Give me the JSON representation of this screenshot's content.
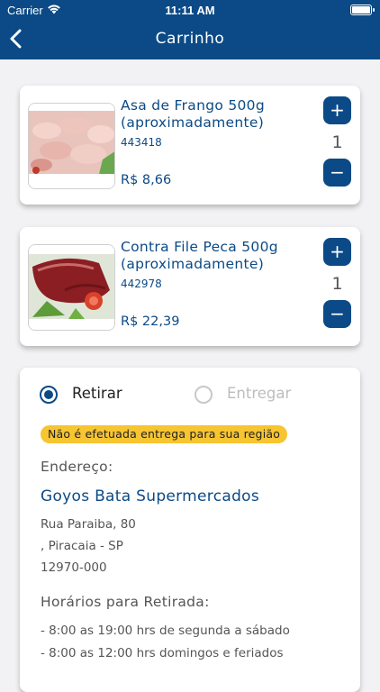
{
  "status_bar": {
    "carrier": "Carrier",
    "time": "11:11 AM"
  },
  "header": {
    "title": "Carrinho"
  },
  "cart": {
    "items": [
      {
        "name": "Asa de Frango 500g (aproximadamente)",
        "code": "443418",
        "price": "R$ 8,66",
        "quantity": "1",
        "plus": "+",
        "minus": "−"
      },
      {
        "name": "Contra File Peca 500g (aproximadamente)",
        "code": "442978",
        "price": "R$ 22,39",
        "quantity": "1",
        "plus": "+",
        "minus": "−"
      }
    ]
  },
  "delivery": {
    "options": [
      {
        "label": "Retirar",
        "selected": true
      },
      {
        "label": "Entregar",
        "selected": false
      }
    ],
    "warning": "Não é efetuada entrega para sua região",
    "address_label": "Endereço:",
    "store_name": "Goyos Bata Supermercados",
    "address_lines": [
      "Rua Paraiba, 80",
      ", Piracaia - SP",
      "12970-000"
    ],
    "hours_label": "Horários para Retirada:",
    "hours": [
      "- 8:00 as 19:00 hrs de segunda a sábado",
      "- 8:00 as 12:00 hrs domingos e feriados"
    ]
  },
  "colors": {
    "primary": "#0b4a86",
    "badge": "#f6c531"
  }
}
